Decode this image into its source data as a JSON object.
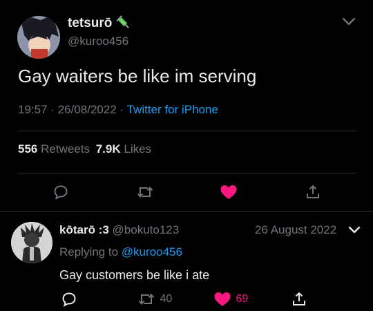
{
  "tweet": {
    "display_name": "tetsurō",
    "name_emoji": "syringe-emoji",
    "handle": "@kuroo456",
    "text": "Gay waiters be like im serving",
    "time": "19:57",
    "sep1": "·",
    "date": "26/08/2022",
    "sep2": "·",
    "source": "Twitter for iPhone",
    "retweets_count": "556",
    "retweets_label": "Retweets",
    "likes_count": "7.9K",
    "likes_label": "Likes"
  },
  "reply": {
    "display_name": "kōtarō :3",
    "handle": "@bokuto123",
    "date": "26 August 2022",
    "replying_to_label": "Replying to",
    "replying_to_handle": "@kuroo456",
    "text": "Gay customers be like i ate",
    "retweets_count": "40",
    "likes_count": "69"
  },
  "colors": {
    "background": "#000000",
    "accent_blue": "#1d9bf0",
    "like_red": "#f91880",
    "muted": "#71767b"
  },
  "icons": {
    "reply": "comment-bubble-icon",
    "retweet": "retweet-arrows-icon",
    "like": "heart-icon",
    "share": "share-upload-icon",
    "more": "chevron-down-icon"
  }
}
